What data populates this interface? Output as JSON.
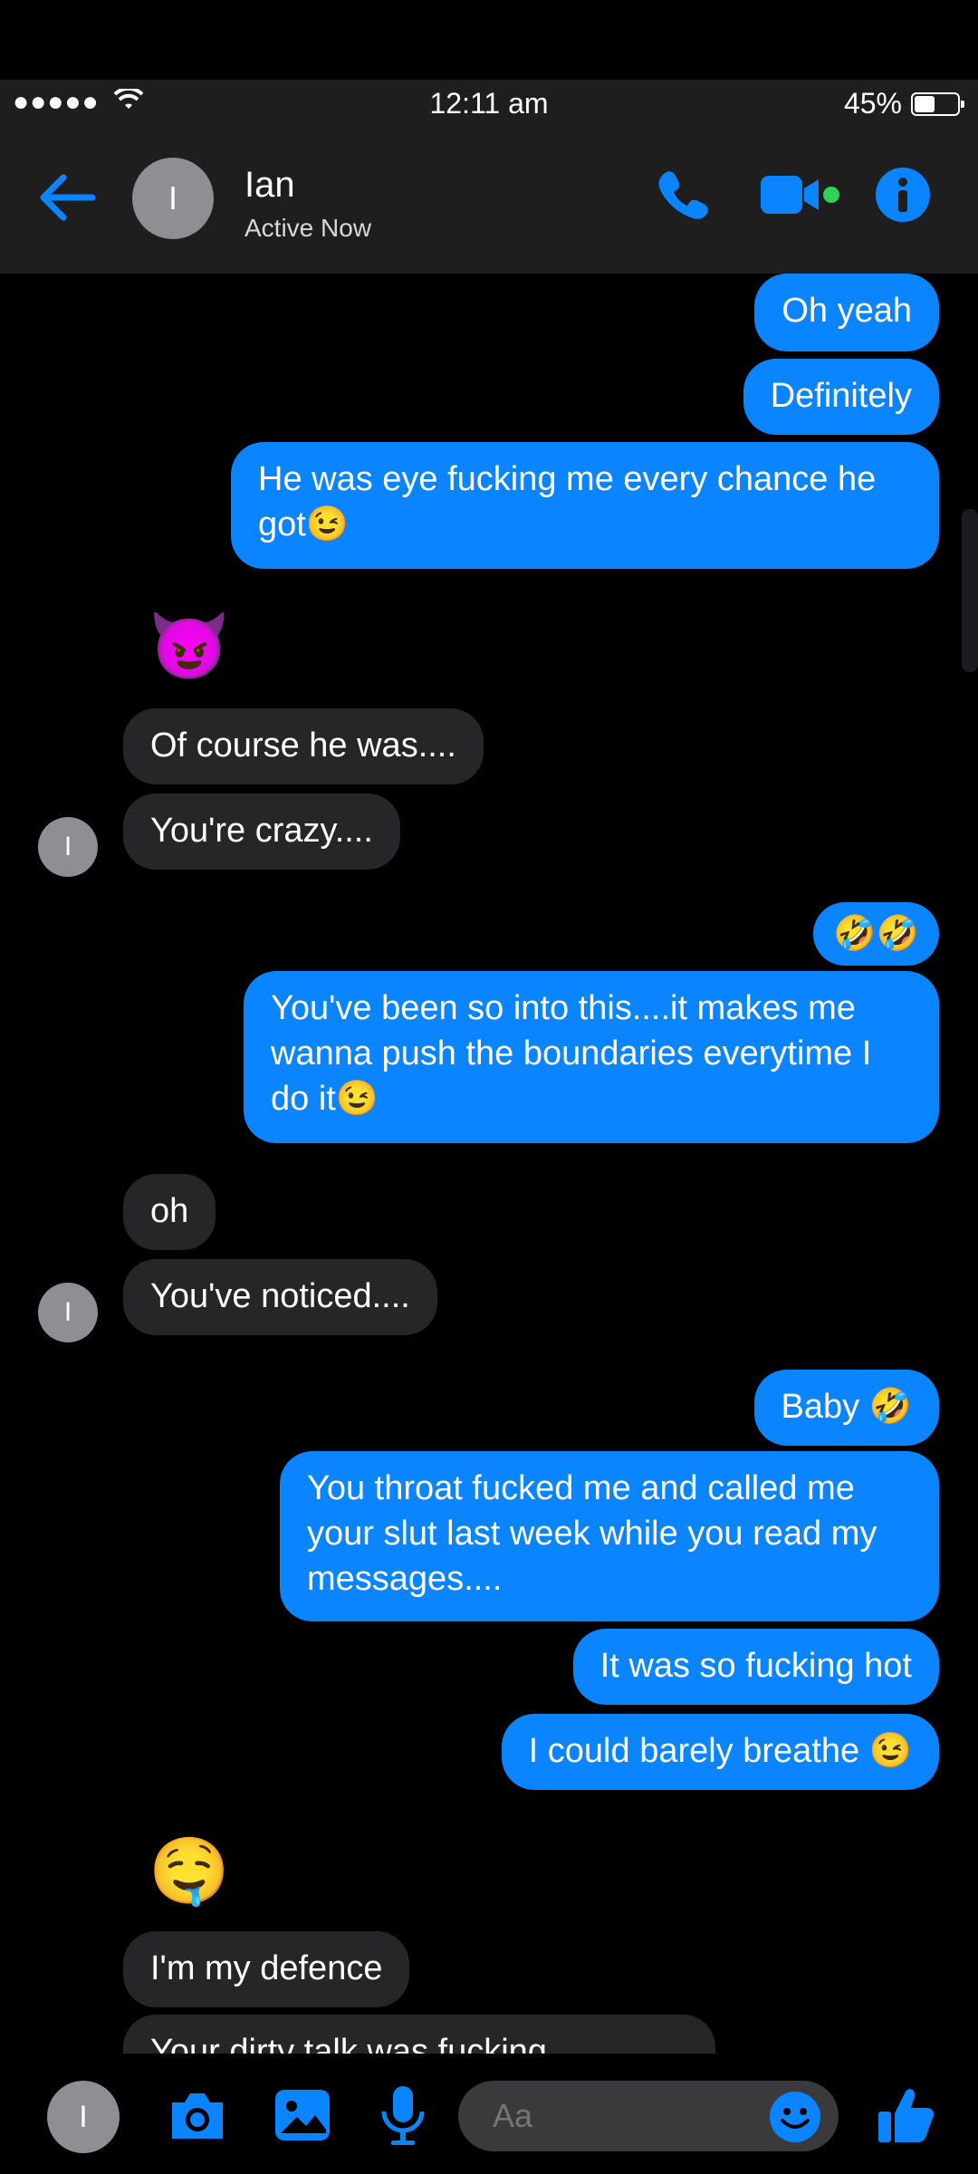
{
  "status": {
    "signal": "●●●●●",
    "time": "12:11 am",
    "battery": "45%"
  },
  "header": {
    "avatar_initial": "I",
    "name": "Ian",
    "presence": "Active Now"
  },
  "messages": [
    {
      "side": "out",
      "text": "Oh yeah"
    },
    {
      "side": "out",
      "text": "Definitely"
    },
    {
      "side": "out",
      "text": "He was eye fucking me every chance he got😉"
    },
    {
      "side": "in_emoji",
      "text": "😈"
    },
    {
      "side": "in",
      "text": "Of course he was...."
    },
    {
      "side": "in",
      "text": "You're crazy...."
    },
    {
      "side": "out",
      "text": "🤣🤣"
    },
    {
      "side": "out",
      "text": "You've been so into this....it makes me wanna push the boundaries everytime I do it😉"
    },
    {
      "side": "in",
      "text": "oh"
    },
    {
      "side": "in",
      "text": "You've noticed...."
    },
    {
      "side": "out",
      "text": "Baby 🤣"
    },
    {
      "side": "out",
      "text": "You throat fucked me and called me your slut last week while you read my messages...."
    },
    {
      "side": "out",
      "text": "It was so fucking hot"
    },
    {
      "side": "out",
      "text": "I could barely breathe 😉"
    },
    {
      "side": "in_emoji",
      "text": "🤤"
    },
    {
      "side": "in",
      "text": "I'm my defence"
    },
    {
      "side": "in",
      "text": "Your dirty talk was fucking"
    }
  ],
  "chat_avatar_initial": "I",
  "composer": {
    "avatar_initial": "I",
    "placeholder": "Aa"
  },
  "colors": {
    "accent": "#0a84ff",
    "incoming": "#262628",
    "green": "#30d158"
  },
  "icons": [
    "back-arrow-icon",
    "phone-icon",
    "video-icon",
    "info-icon",
    "wifi-icon",
    "camera-icon",
    "gallery-icon",
    "microphone-icon",
    "smile-icon",
    "thumbs-up-icon"
  ]
}
